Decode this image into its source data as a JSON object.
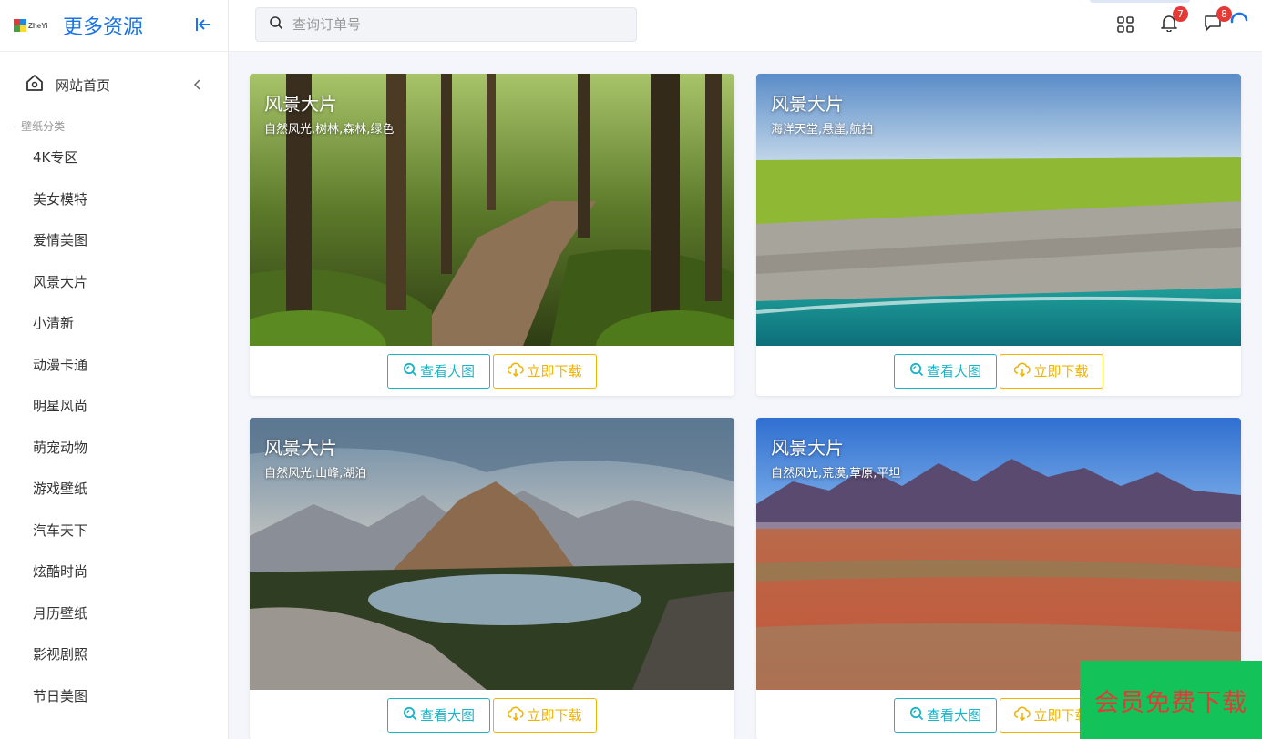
{
  "brand": {
    "logo_text": "ZheYi",
    "title": "更多资源"
  },
  "sidebar": {
    "home_label": "网站首页",
    "section_title": "- 壁纸分类-",
    "categories": [
      "4K专区",
      "美女模特",
      "爱情美图",
      "风景大片",
      "小清新",
      "动漫卡通",
      "明星风尚",
      "萌宠动物",
      "游戏壁纸",
      "汽车天下",
      "炫酷时尚",
      "月历壁纸",
      "影视剧照",
      "节日美图"
    ]
  },
  "search": {
    "placeholder": "查询订单号",
    "value": ""
  },
  "topbar": {
    "icons": [
      "apps-grid-icon",
      "bell-icon",
      "message-icon",
      "loading-spinner-icon"
    ],
    "notifications_count": "7",
    "messages_count": "8"
  },
  "cards": [
    {
      "title": "风景大片",
      "tags": "自然风光,树林,森林,绿色",
      "view_label": "查看大图",
      "download_label": "立即下载"
    },
    {
      "title": "风景大片",
      "tags": "海洋天堂,悬崖,航拍",
      "view_label": "查看大图",
      "download_label": "立即下载"
    },
    {
      "title": "风景大片",
      "tags": "自然风光,山峰,湖泊",
      "view_label": "查看大图",
      "download_label": "立即下载"
    },
    {
      "title": "风景大片",
      "tags": "自然风光,荒漠,草原,平坦",
      "view_label": "查看大图",
      "download_label": "立即下载"
    }
  ],
  "promo": {
    "label": "会员免费下载"
  },
  "colors": {
    "accent": "#1a73e8",
    "view_button": "#1cb4c8",
    "download_button": "#f0b400",
    "badge": "#e53935",
    "promo_bg": "#14c25a",
    "promo_text": "#e53935"
  }
}
